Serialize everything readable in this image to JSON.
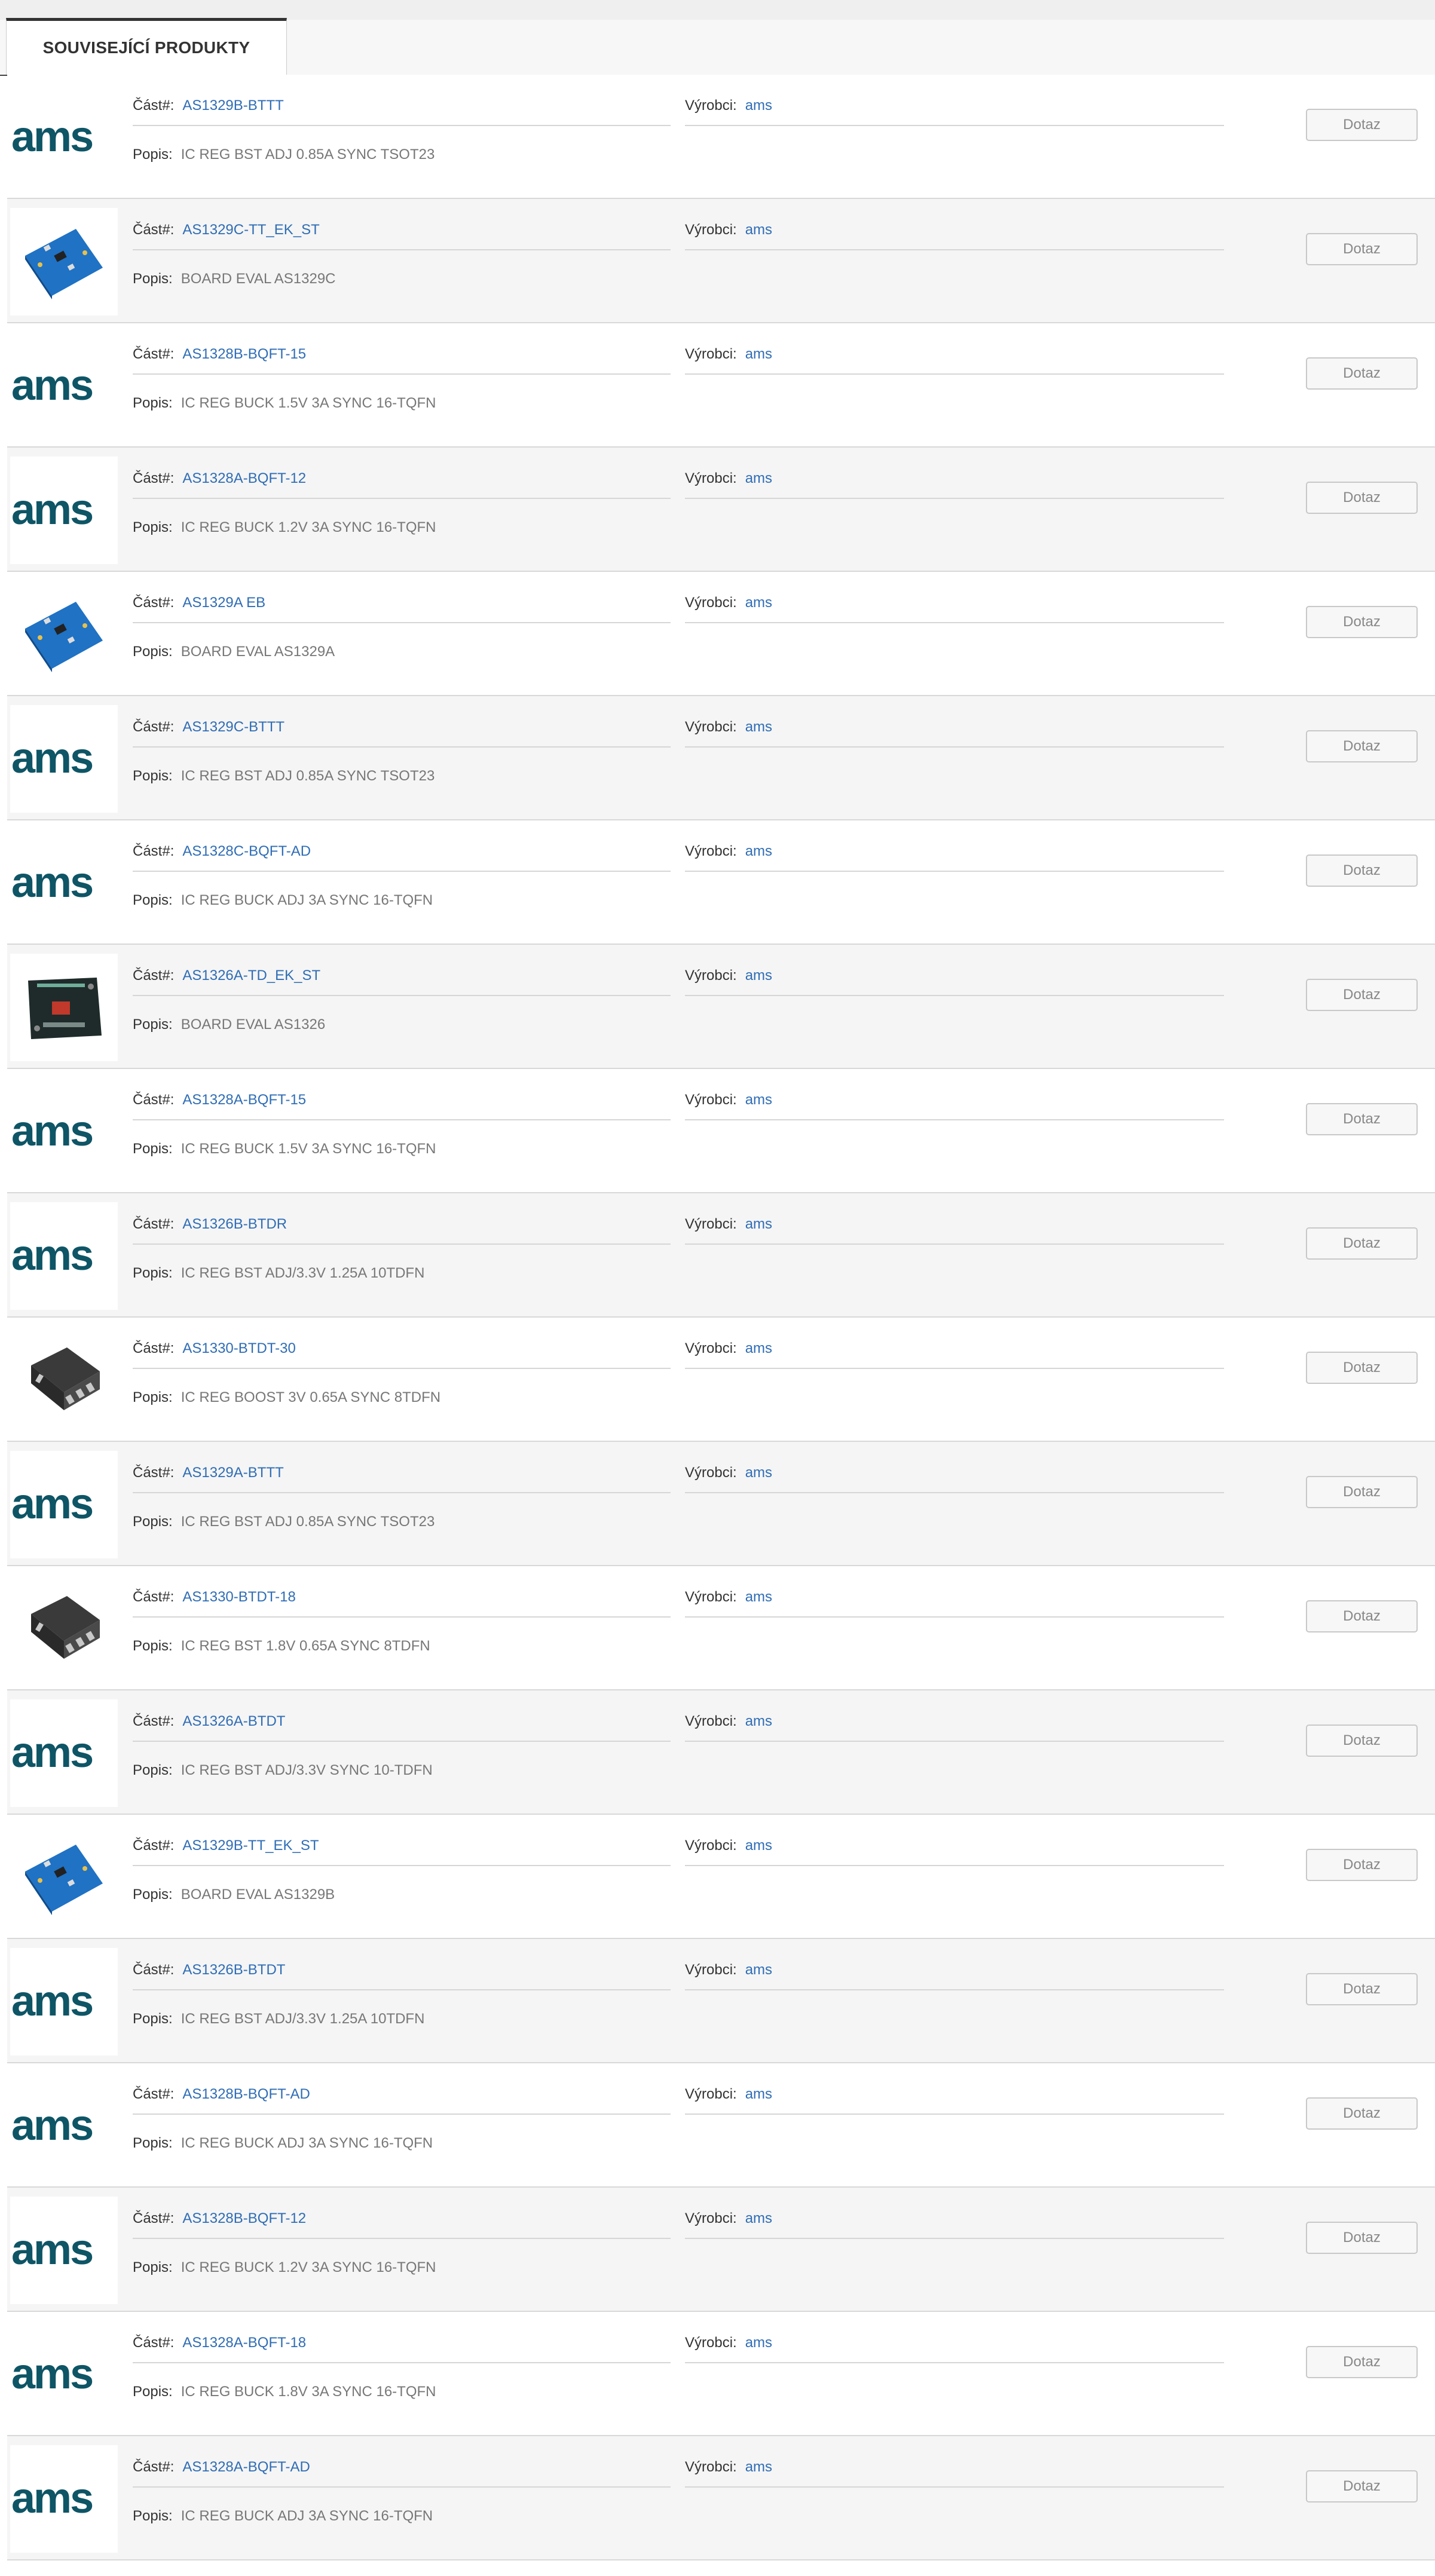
{
  "tab": {
    "label": "SOUVISEJÍCÍ PRODUKTY"
  },
  "labels": {
    "part": "Část#:",
    "manufacturer": "Výrobci:",
    "description": "Popis:",
    "inquiry": "Dotaz"
  },
  "logo_text": "ams",
  "colors": {
    "link": "#2f6db5",
    "logo": "#0e5566",
    "board": "#1f72c4",
    "row_alt": "#f5f5f5"
  },
  "products": [
    {
      "part": "AS1329B-BTTT",
      "manufacturer": "ams",
      "description": "IC REG BST ADJ 0.85A SYNC TSOT23",
      "image": "ams-logo"
    },
    {
      "part": "AS1329C-TT_EK_ST",
      "manufacturer": "ams",
      "description": "BOARD EVAL AS1329C",
      "image": "eval-board-blue"
    },
    {
      "part": "AS1328B-BQFT-15",
      "manufacturer": "ams",
      "description": "IC REG BUCK 1.5V 3A SYNC 16-TQFN",
      "image": "ams-logo"
    },
    {
      "part": "AS1328A-BQFT-12",
      "manufacturer": "ams",
      "description": "IC REG BUCK 1.2V 3A SYNC 16-TQFN",
      "image": "ams-logo"
    },
    {
      "part": "AS1329A EB",
      "manufacturer": "ams",
      "description": "BOARD EVAL AS1329A",
      "image": "eval-board-blue"
    },
    {
      "part": "AS1329C-BTTT",
      "manufacturer": "ams",
      "description": "IC REG BST ADJ 0.85A SYNC TSOT23",
      "image": "ams-logo"
    },
    {
      "part": "AS1328C-BQFT-AD",
      "manufacturer": "ams",
      "description": "IC REG BUCK ADJ 3A SYNC 16-TQFN",
      "image": "ams-logo"
    },
    {
      "part": "AS1326A-TD_EK_ST",
      "manufacturer": "ams",
      "description": "BOARD EVAL AS1326",
      "image": "eval-board-dark"
    },
    {
      "part": "AS1328A-BQFT-15",
      "manufacturer": "ams",
      "description": "IC REG BUCK 1.5V 3A SYNC 16-TQFN",
      "image": "ams-logo"
    },
    {
      "part": "AS1326B-BTDR",
      "manufacturer": "ams",
      "description": "IC REG BST ADJ/3.3V 1.25A 10TDFN",
      "image": "ams-logo"
    },
    {
      "part": "AS1330-BTDT-30",
      "manufacturer": "ams",
      "description": "IC REG BOOST 3V 0.65A SYNC 8TDFN",
      "image": "chip-package"
    },
    {
      "part": "AS1329A-BTTT",
      "manufacturer": "ams",
      "description": "IC REG BST ADJ 0.85A SYNC TSOT23",
      "image": "ams-logo"
    },
    {
      "part": "AS1330-BTDT-18",
      "manufacturer": "ams",
      "description": "IC REG BST 1.8V 0.65A SYNC 8TDFN",
      "image": "chip-package"
    },
    {
      "part": "AS1326A-BTDT",
      "manufacturer": "ams",
      "description": "IC REG BST ADJ/3.3V SYNC 10-TDFN",
      "image": "ams-logo"
    },
    {
      "part": "AS1329B-TT_EK_ST",
      "manufacturer": "ams",
      "description": "BOARD EVAL AS1329B",
      "image": "eval-board-blue"
    },
    {
      "part": "AS1326B-BTDT",
      "manufacturer": "ams",
      "description": "IC REG BST ADJ/3.3V 1.25A 10TDFN",
      "image": "ams-logo"
    },
    {
      "part": "AS1328B-BQFT-AD",
      "manufacturer": "ams",
      "description": "IC REG BUCK ADJ 3A SYNC 16-TQFN",
      "image": "ams-logo"
    },
    {
      "part": "AS1328B-BQFT-12",
      "manufacturer": "ams",
      "description": "IC REG BUCK 1.2V 3A SYNC 16-TQFN",
      "image": "ams-logo"
    },
    {
      "part": "AS1328A-BQFT-18",
      "manufacturer": "ams",
      "description": "IC REG BUCK 1.8V 3A SYNC 16-TQFN",
      "image": "ams-logo"
    },
    {
      "part": "AS1328A-BQFT-AD",
      "manufacturer": "ams",
      "description": "IC REG BUCK ADJ 3A SYNC 16-TQFN",
      "image": "ams-logo"
    }
  ]
}
